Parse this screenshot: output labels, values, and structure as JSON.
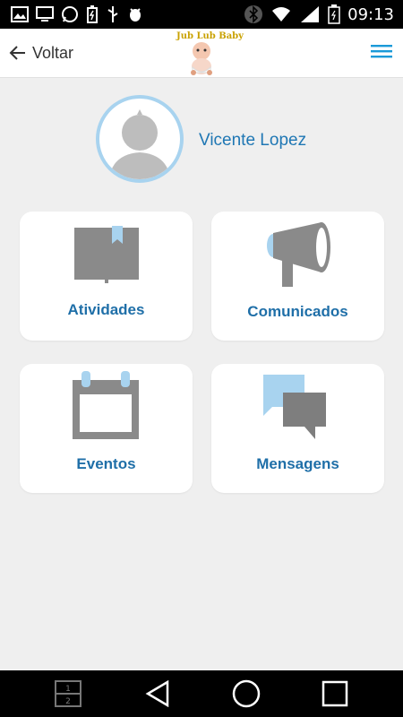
{
  "status_bar": {
    "time": "09:13"
  },
  "header": {
    "back_label": "Voltar",
    "logo_text": "Jub Lub Baby"
  },
  "profile": {
    "name": "Vicente Lopez"
  },
  "cards": [
    {
      "label": "Atividades",
      "icon": "book-icon"
    },
    {
      "label": "Comunicados",
      "icon": "megaphone-icon"
    },
    {
      "label": "Eventos",
      "icon": "calendar-icon"
    },
    {
      "label": "Mensagens",
      "icon": "chat-icon"
    }
  ],
  "colors": {
    "accent": "#1f77b4",
    "icon_gray": "#8a8a8a",
    "icon_light_blue": "#a8d3ef",
    "background": "#efefef"
  }
}
